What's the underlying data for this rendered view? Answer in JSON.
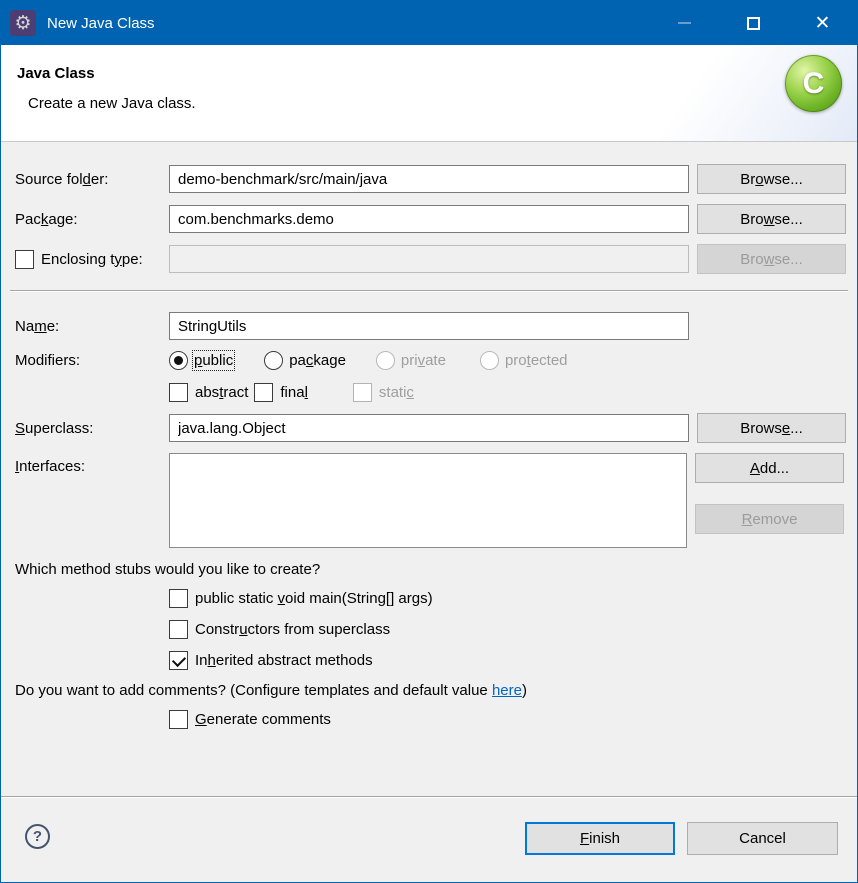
{
  "window": {
    "title": "New Java Class",
    "accent_color": "#0063b1",
    "icons": {
      "app_icon": "gear-on-purple",
      "app_icon_glyph": "⚙",
      "minimize": "minimize-dash",
      "maximize": "maximize-square",
      "close_glyph": "✕",
      "banner": "green-class-ball",
      "banner_letter": "C",
      "help_glyph": "?"
    }
  },
  "header": {
    "title": "Java Class",
    "subtitle": "Create a new Java class."
  },
  "form": {
    "source_folder": {
      "label": "Source fol_der:",
      "value": "demo-benchmark/src/main/java",
      "browse": "Br_owse..."
    },
    "package": {
      "label": "Pac_kage:",
      "value": "com.benchmarks.demo",
      "browse": "Bro_wse..."
    },
    "enclosing_type": {
      "label": "Enclosing t_ype:",
      "checked": false,
      "value": "",
      "browse": "Bro_wse...",
      "browse_disabled": true
    },
    "name": {
      "label": "Na_me:",
      "value": "StringUtils"
    },
    "modifiers": {
      "label": "Modifiers:",
      "radios": [
        {
          "label": "_public",
          "state": "selected",
          "focused": true
        },
        {
          "label": "pa_ckage",
          "state": "enabled"
        },
        {
          "label": "pri_vate",
          "state": "disabled"
        },
        {
          "label": "pro_tected",
          "state": "disabled"
        }
      ],
      "checkboxes": [
        {
          "label": "abs_tract",
          "checked": false,
          "disabled": false
        },
        {
          "label": "fina_l",
          "checked": false,
          "disabled": false
        },
        {
          "label": "stati_c",
          "checked": false,
          "disabled": true
        }
      ]
    },
    "superclass": {
      "label": "_Superclass:",
      "value": "java.lang.Object",
      "browse": "Brows_e..."
    },
    "interfaces": {
      "label": "_Interfaces:",
      "items": [],
      "add": "_Add...",
      "remove": "_Remove",
      "remove_disabled": true
    },
    "stubs": {
      "question": "Which method stubs would you like to create?",
      "options": [
        {
          "label": "public static _void main(String[] args)",
          "checked": false
        },
        {
          "label": "Constr_uctors from superclass",
          "checked": false
        },
        {
          "label": "In_herited abstract methods",
          "checked": true
        }
      ]
    },
    "comments": {
      "question_prefix": "Do you want to add comments? (Configure templates and default value ",
      "link": "here",
      "suffix": ")",
      "generate": {
        "label": "_Generate comments",
        "checked": false
      }
    }
  },
  "footer": {
    "finish": "_Finish",
    "cancel": "Cancel"
  }
}
